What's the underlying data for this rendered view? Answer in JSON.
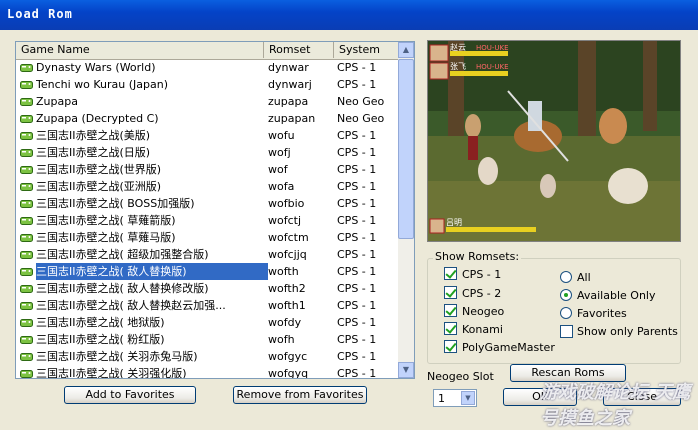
{
  "window": {
    "title": "Load Rom"
  },
  "list": {
    "columns": [
      "Game Name",
      "Romset",
      "System"
    ],
    "rows": [
      {
        "name": "Dynasty Wars (World)",
        "romset": "dynwar",
        "system": "CPS - 1"
      },
      {
        "name": "Tenchi wo Kurau (Japan)",
        "romset": "dynwarj",
        "system": "CPS - 1"
      },
      {
        "name": "Zupapa",
        "romset": "zupapa",
        "system": "Neo Geo"
      },
      {
        "name": "Zupapa (Decrypted C)",
        "romset": "zupapan",
        "system": "Neo Geo"
      },
      {
        "name": "三国志II赤壁之战(美版)",
        "romset": "wofu",
        "system": "CPS - 1"
      },
      {
        "name": "三国志II赤壁之战(日版)",
        "romset": "wofj",
        "system": "CPS - 1"
      },
      {
        "name": "三国志II赤壁之战(世界版)",
        "romset": "wof",
        "system": "CPS - 1"
      },
      {
        "name": "三国志II赤壁之战(亚洲版)",
        "romset": "wofa",
        "system": "CPS - 1"
      },
      {
        "name": "三国志II赤壁之战( BOSS加强版)",
        "romset": "wofbio",
        "system": "CPS - 1"
      },
      {
        "name": "三国志II赤壁之战( 草薙箭版)",
        "romset": "wofctj",
        "system": "CPS - 1"
      },
      {
        "name": "三国志II赤壁之战( 草薙马版)",
        "romset": "wofctm",
        "system": "CPS - 1"
      },
      {
        "name": "三国志II赤壁之战( 超级加强整合版)",
        "romset": "wofcjjq",
        "system": "CPS - 1"
      },
      {
        "name": "三国志II赤壁之战( 敌人替换版)",
        "romset": "wofth",
        "system": "CPS - 1",
        "selected": true
      },
      {
        "name": "三国志II赤壁之战( 敌人替换修改版)",
        "romset": "wofth2",
        "system": "CPS - 1"
      },
      {
        "name": "三国志II赤壁之战( 敌人替换赵云加强...",
        "romset": "wofth1",
        "system": "CPS - 1"
      },
      {
        "name": "三国志II赤壁之战( 地狱版)",
        "romset": "wofdy",
        "system": "CPS - 1"
      },
      {
        "name": "三国志II赤壁之战( 粉红版)",
        "romset": "wofh",
        "system": "CPS - 1"
      },
      {
        "name": "三国志II赤壁之战( 关羽赤兔马版)",
        "romset": "wofgyc",
        "system": "CPS - 1"
      },
      {
        "name": "三国志II赤壁之战( 关羽强化版)",
        "romset": "wofgyq",
        "system": "CPS - 1"
      }
    ]
  },
  "buttons": {
    "add_favorites": "Add to Favorites",
    "remove_favorites": "Remove from Favorites",
    "rescan": "Rescan Roms",
    "ok": "OK",
    "close": "Close"
  },
  "preview": {
    "hud": {
      "p1_name": "赵云",
      "p2_name": "张飞",
      "p1_score": "HOU-UKE",
      "p2_score": "HOU-UKE",
      "boss_name": "吕明"
    }
  },
  "show_romsets": {
    "title": "Show Romsets:",
    "checkboxes": [
      {
        "label": "CPS - 1",
        "checked": true
      },
      {
        "label": "CPS - 2",
        "checked": true
      },
      {
        "label": "Neogeo",
        "checked": true
      },
      {
        "label": "Konami",
        "checked": true
      },
      {
        "label": "PolyGameMaster",
        "checked": true
      }
    ],
    "radios": [
      {
        "label": "All",
        "checked": false
      },
      {
        "label": "Available Only",
        "checked": true
      },
      {
        "label": "Favorites",
        "checked": false
      }
    ],
    "parents_only": {
      "label": "Show only Parents",
      "checked": false
    }
  },
  "neogeo_slot": {
    "label": "Neogeo Slot",
    "value": "1"
  },
  "watermark": "游戏破解论坛 天鹰号摸鱼之家",
  "colors": {
    "title_bar": "#0A5FE0",
    "selection": "#316AC5",
    "window_bg": "#ECE9D8"
  }
}
